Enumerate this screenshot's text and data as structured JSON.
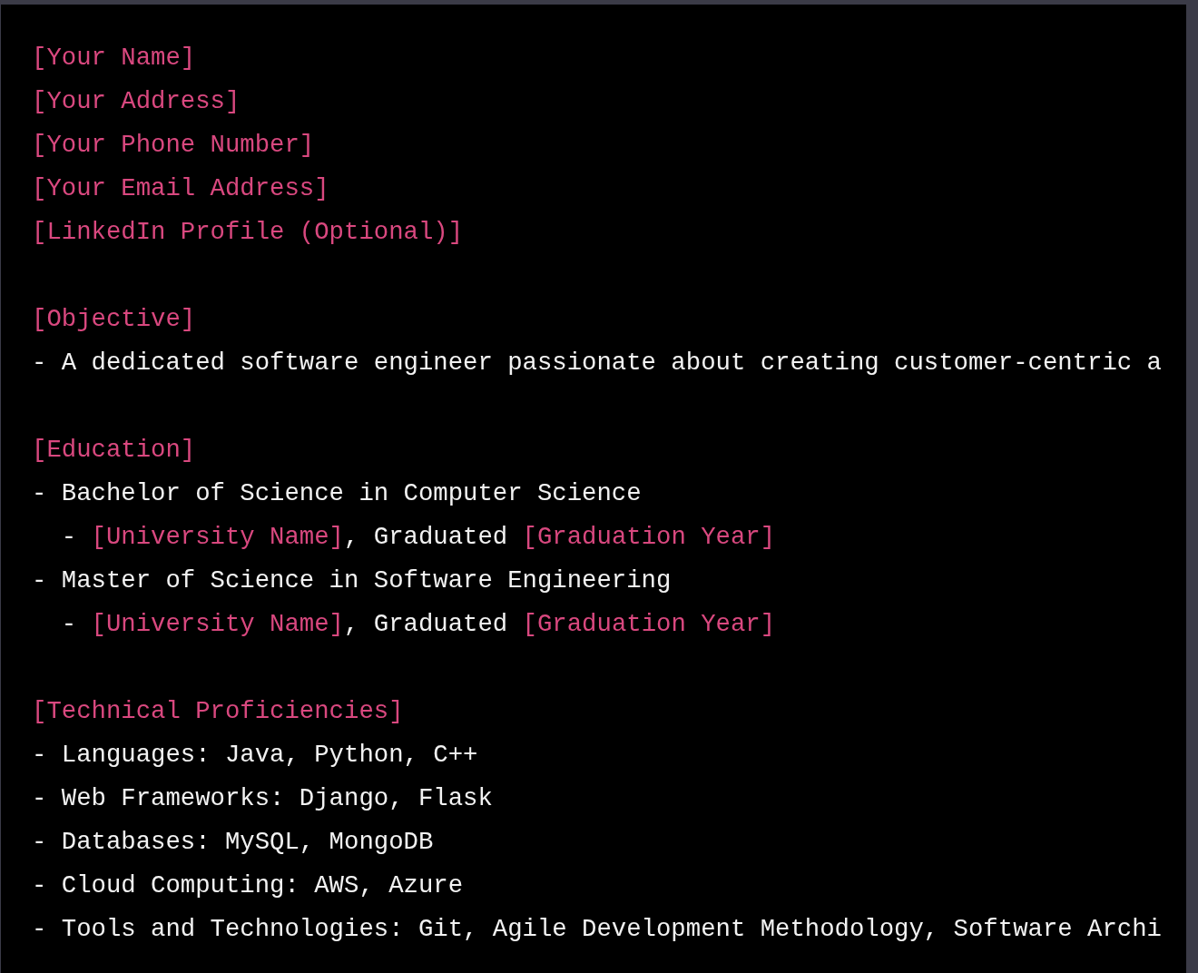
{
  "code_block": {
    "sections": [
      {
        "lines": [
          [
            {
              "kind": "placeholder",
              "text": "[Your Name]"
            }
          ],
          [
            {
              "kind": "placeholder",
              "text": "[Your Address]"
            }
          ],
          [
            {
              "kind": "placeholder",
              "text": "[Your Phone Number]"
            }
          ],
          [
            {
              "kind": "placeholder",
              "text": "[Your Email Address]"
            }
          ],
          [
            {
              "kind": "placeholder",
              "text": "[LinkedIn Profile (Optional)]"
            }
          ]
        ]
      },
      {
        "lines": [
          [
            {
              "kind": "placeholder",
              "text": "[Objective]"
            }
          ],
          [
            {
              "kind": "text",
              "text": "- A dedicated software engineer passionate about creating customer-centric a"
            }
          ]
        ]
      },
      {
        "lines": [
          [
            {
              "kind": "placeholder",
              "text": "[Education]"
            }
          ],
          [
            {
              "kind": "text",
              "text": "- Bachelor of Science in Computer Science"
            }
          ],
          [
            {
              "kind": "text",
              "text": "  - "
            },
            {
              "kind": "placeholder",
              "text": "[University Name]"
            },
            {
              "kind": "text",
              "text": ", Graduated "
            },
            {
              "kind": "placeholder",
              "text": "[Graduation Year]"
            }
          ],
          [
            {
              "kind": "text",
              "text": "- Master of Science in Software Engineering"
            }
          ],
          [
            {
              "kind": "text",
              "text": "  - "
            },
            {
              "kind": "placeholder",
              "text": "[University Name]"
            },
            {
              "kind": "text",
              "text": ", Graduated "
            },
            {
              "kind": "placeholder",
              "text": "[Graduation Year]"
            }
          ]
        ]
      },
      {
        "lines": [
          [
            {
              "kind": "placeholder",
              "text": "[Technical Proficiencies]"
            }
          ],
          [
            {
              "kind": "text",
              "text": "- Languages: Java, Python, C++"
            }
          ],
          [
            {
              "kind": "text",
              "text": "- Web Frameworks: Django, Flask"
            }
          ],
          [
            {
              "kind": "text",
              "text": "- Databases: MySQL, MongoDB"
            }
          ],
          [
            {
              "kind": "text",
              "text": "- Cloud Computing: AWS, Azure"
            }
          ],
          [
            {
              "kind": "text",
              "text": "- Tools and Technologies: Git, Agile Development Methodology, Software Archi"
            }
          ]
        ]
      }
    ]
  }
}
